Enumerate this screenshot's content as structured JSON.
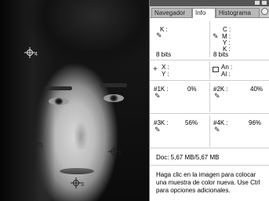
{
  "tabs": [
    {
      "label": "Navegador",
      "active": false
    },
    {
      "label": "Info",
      "active": true
    },
    {
      "label": "Histograma",
      "active": false
    }
  ],
  "color_readout": {
    "left": {
      "label": "K :",
      "value": "",
      "bits": "8 bits"
    },
    "right": {
      "labels": [
        "C :",
        "M :",
        "Y :",
        "K :"
      ],
      "values": [
        "",
        "",
        "",
        ""
      ],
      "bits": "8 bits"
    }
  },
  "position_readout": {
    "xy_labels": [
      "X :",
      "Y :"
    ],
    "size_labels": [
      "An :",
      "Al :"
    ]
  },
  "samplers": [
    {
      "label": "#1K :",
      "value": "0%"
    },
    {
      "label": "#2K :",
      "value": "40%"
    },
    {
      "label": "#3K :",
      "value": "56%"
    },
    {
      "label": "#4K :",
      "value": "96%"
    }
  ],
  "photo_markers": [
    "1",
    "2",
    "3",
    "4"
  ],
  "doc_info": "Doc: 5,67 MB/5,67 MB",
  "help_text": "Haga clic en la imagen para colocar una muestra de color nueva. Use Ctrl para opciones adicionales.",
  "icons": [
    "eyedropper-icon",
    "crosshair-icon",
    "selection-size-icon",
    "color-sampler-icon",
    "panel-menu-icon"
  ]
}
